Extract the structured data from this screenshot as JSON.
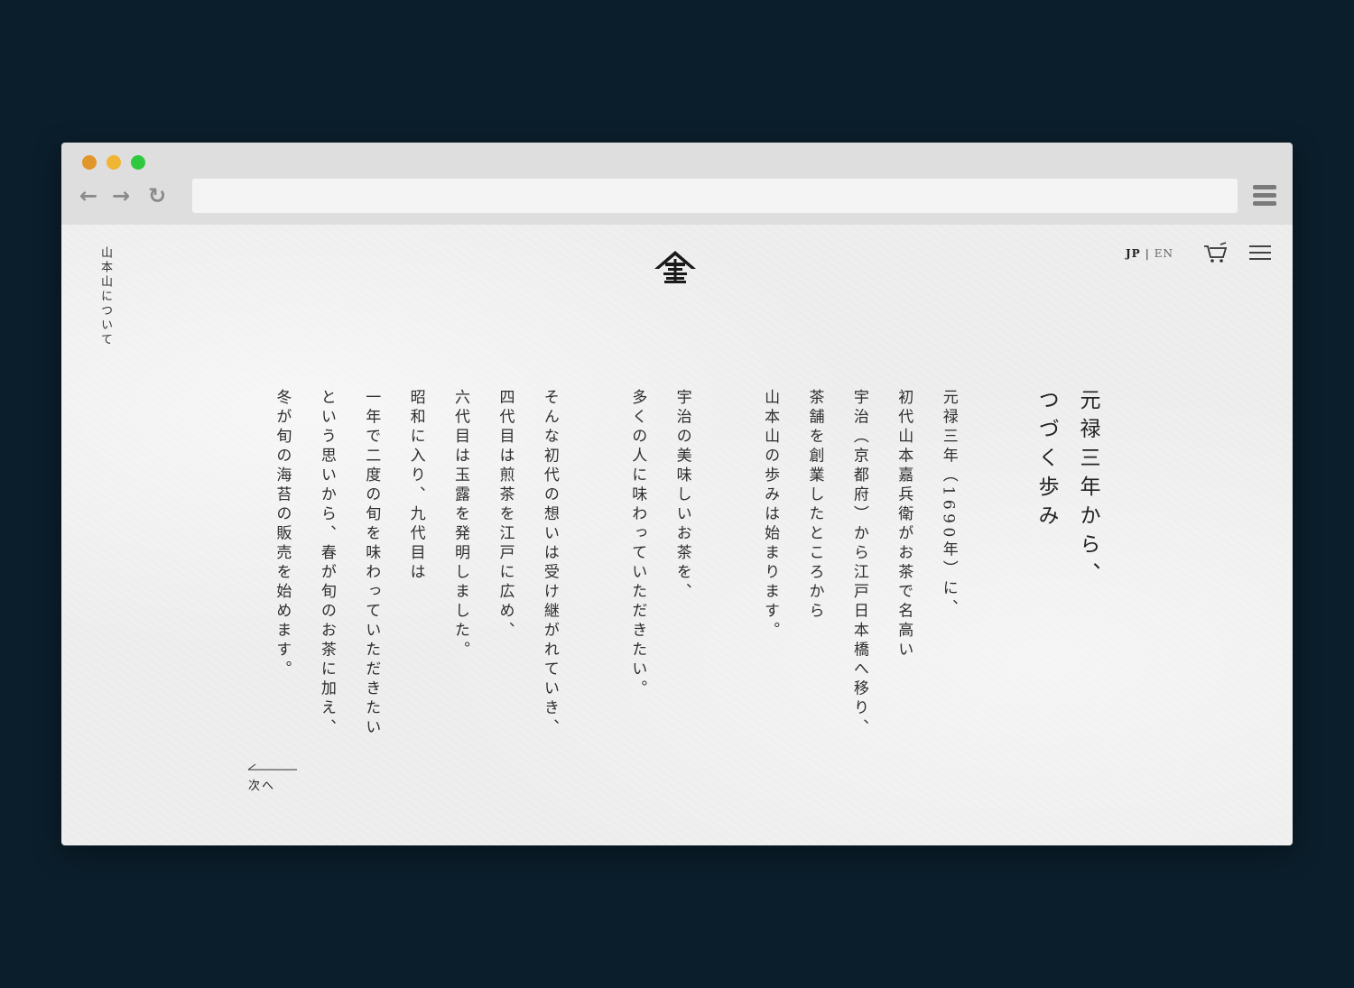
{
  "window": {
    "controls": [
      "close",
      "minimize",
      "maximize"
    ],
    "nav_icons": {
      "back": "arrow-left-icon",
      "forward": "arrow-right-icon",
      "reload": "reload-icon"
    },
    "back_glyph": "←",
    "forward_glyph": "→",
    "reload_glyph": "↻",
    "url": "",
    "menu_icon": "hamburger-icon"
  },
  "page": {
    "side_nav_label": "山本山について",
    "logo_icon": "yamamotoyama-crest-logo",
    "lang": {
      "jp": "JP",
      "separator": "|",
      "en": "EN"
    },
    "cart_icon": "cart-icon",
    "menu_icon": "hamburger-menu-icon",
    "heading_lines": [
      "元禄三年から、",
      "つづく歩み"
    ],
    "body_paragraphs": [
      [
        "元禄三年（1690年）に、",
        "初代山本嘉兵衛がお茶で名高い",
        "宇治（京都府）から江戸日本橋へ移り、",
        "茶舗を創業したところから",
        "山本山の歩みは始まります。"
      ],
      [
        "宇治の美味しいお茶を、",
        "多くの人に味わっていただきたい。"
      ],
      [
        "そんな初代の想いは受け継がれていき、",
        "四代目は煎茶を江戸に広め、",
        "六代目は玉露を発明しました。",
        "昭和に入り、九代目は",
        "一年で二度の旬を味わっていただきたい",
        "という思いから、春が旬のお茶に加え、",
        "冬が旬の海苔の販売を始めます。"
      ]
    ],
    "next_label": "次へ",
    "colors": {
      "background": "#0b1e2b",
      "page": "#eeeeee",
      "text": "#2b2b2b"
    }
  }
}
